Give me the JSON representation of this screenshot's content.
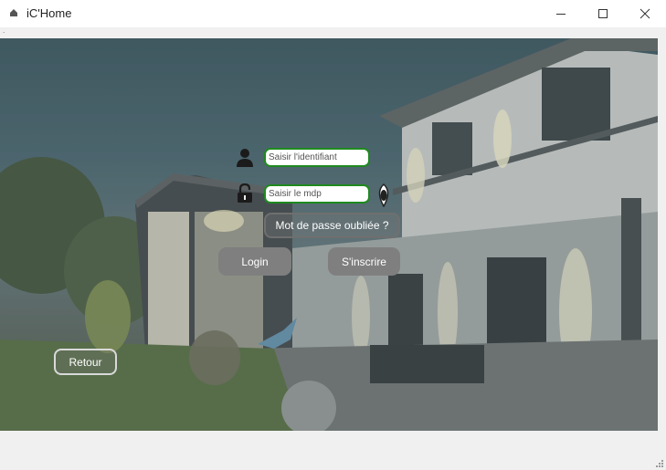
{
  "window": {
    "title": "iC'Home",
    "icon": "app-icon"
  },
  "login": {
    "identifier_placeholder": "Saisir l'identifiant",
    "identifier_value": "",
    "password_placeholder": "Saisir le mdp",
    "password_value": "",
    "forgot_label": "Mot de passe oubliée ?",
    "login_label": "Login",
    "signup_label": "S'inscrire"
  },
  "nav": {
    "back_label": "Retour"
  },
  "colors": {
    "field_border": "#1f8a1f",
    "button_fill": "#7f7f7f",
    "window_bg": "#f0f0f0"
  },
  "icons": [
    "user-icon",
    "lock-icon",
    "show-password-icon",
    "minimize-icon",
    "maximize-icon",
    "close-icon",
    "resize-grip-icon"
  ]
}
